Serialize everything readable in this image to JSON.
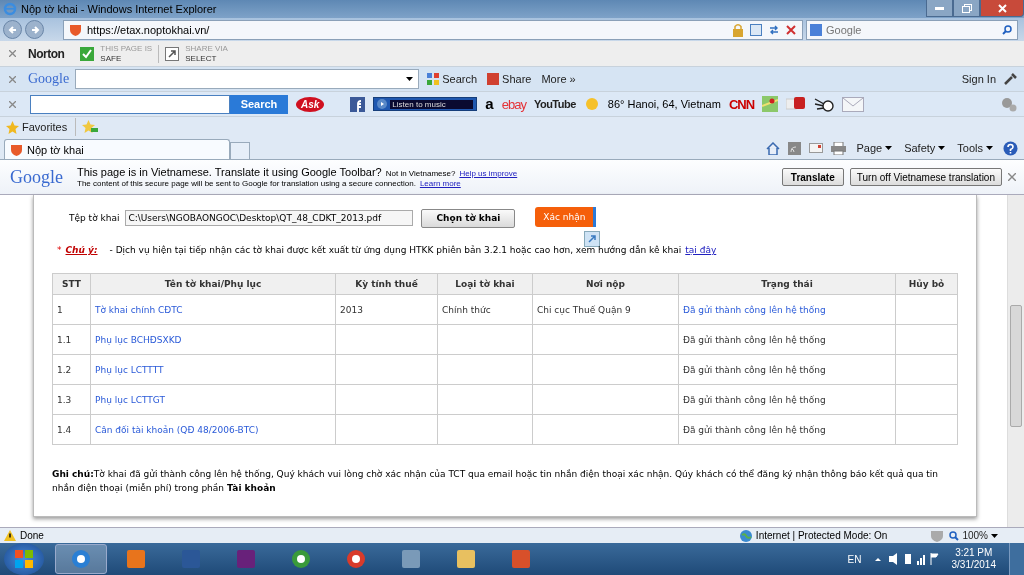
{
  "window": {
    "title": "Nộp tờ khai - Windows Internet Explorer"
  },
  "address": {
    "url": "https://etax.noptokhai.vn/",
    "search_placeholder": "Google"
  },
  "norton": {
    "brand": "Norton",
    "safe_label": "THIS PAGE IS",
    "safe_value": "SAFE",
    "share_label": "SHARE VIA",
    "share_value": "SELECT"
  },
  "google_toolbar": {
    "brand": "Google",
    "search_button": "Search",
    "share_button": "Share",
    "more_button": "More »",
    "sign_in": "Sign In"
  },
  "ask_toolbar": {
    "search_button": "Search",
    "brand": "Ask",
    "music": "Listen to music",
    "weather": "86° Hanoi, 64, Vietnam",
    "links": [
      {
        "kind": "amazon",
        "text": "a"
      },
      {
        "kind": "ebay",
        "text": "ebay"
      },
      {
        "kind": "youtube",
        "text": "YouTube"
      }
    ],
    "news": "CNN"
  },
  "favorites": {
    "label": "Favorites"
  },
  "tabs": [
    {
      "label": "Nộp tờ khai",
      "selected": true
    }
  ],
  "command_bar": [
    "Page",
    "Safety",
    "Tools"
  ],
  "translate_bar": {
    "brand": "Google",
    "message": "This page is in Vietnamese.  Translate it using Google Toolbar?",
    "not_lang": "Not in Vietnamese?",
    "help_link": "Help us improve",
    "note": "The content of this secure page will be sent to Google for translation using a secure connection.",
    "learn_more": "Learn more",
    "buttons": [
      "Translate",
      "Turn off Vietnamese translation"
    ]
  },
  "form": {
    "file_label": "Tệp tờ khai",
    "file_value": "C:\\Users\\NGOBAONGOC\\Desktop\\QT_48_CDKT_2013.pdf",
    "choose_button": "Chọn tờ khai",
    "confirm_button": "Xác nhận",
    "note_star": "*",
    "note_label": "Chú ý:",
    "note_text": "- Dịch vụ hiện tại tiếp nhận các tờ khai được kết xuất từ ứng dụng HTKK phiên bản 3.2.1 hoặc cao hơn, xem hướng dẫn kê khai",
    "note_link": "tại đây"
  },
  "table": {
    "columns": [
      "STT",
      "Tên tờ khai/Phụ lục",
      "Kỳ tính thuế",
      "Loại tờ khai",
      "Nơi nộp",
      "Trạng thái",
      "Hủy bỏ"
    ],
    "rows": [
      {
        "stt": "1",
        "name": "Tờ khai chính CĐTC",
        "period": "2013",
        "type": "Chính thức",
        "office": "Chi cục Thuế Quận 9",
        "status": "Đã gửi thành công lên hệ thống",
        "status_link": true
      },
      {
        "stt": "1.1",
        "name": "Phụ lục BCHĐSXKD",
        "status": "Đã gửi thành công lên hệ thống",
        "status_link": false
      },
      {
        "stt": "1.2",
        "name": "Phụ lục LCTTTT",
        "status": "Đã gửi thành công lên hệ thống",
        "status_link": false
      },
      {
        "stt": "1.3",
        "name": "Phụ lục LCTTGT",
        "status": "Đã gửi thành công lên hệ thống",
        "status_link": false
      },
      {
        "stt": "1.4",
        "name": "Cân đối tài khoản (QĐ 48/2006-BTC)",
        "status": "Đã gửi thành công lên hệ thống",
        "status_link": false
      }
    ]
  },
  "footer_note": "**Ghi chú:**Tờ khai đã gửi thành công lên hệ thống, Quý khách vui lòng chờ xác nhận của TCT qua email hoặc tin nhắn điện thoại xác nhận. Qúy khách có thể đăng ký nhận thông báo kết quả qua tin nhắn điện thoại (miễn phí) trong phần **Tài khoản**",
  "status_bar": {
    "text": "Done",
    "zone": "Internet | Protected Mode: On",
    "zoom": "100%"
  },
  "taskbar": {
    "apps": [
      {
        "kind": "browser",
        "selected": true
      },
      {
        "kind": "media",
        "selected": false
      },
      {
        "kind": "word",
        "selected": false
      },
      {
        "kind": "studio",
        "selected": false
      },
      {
        "kind": "green",
        "selected": false
      },
      {
        "kind": "chrome",
        "selected": false
      },
      {
        "kind": "calculator",
        "selected": false
      },
      {
        "kind": "folder",
        "selected": false
      },
      {
        "kind": "tool",
        "selected": false
      }
    ],
    "language": "EN",
    "time": "3:21 PM",
    "date": "3/31/2014"
  }
}
